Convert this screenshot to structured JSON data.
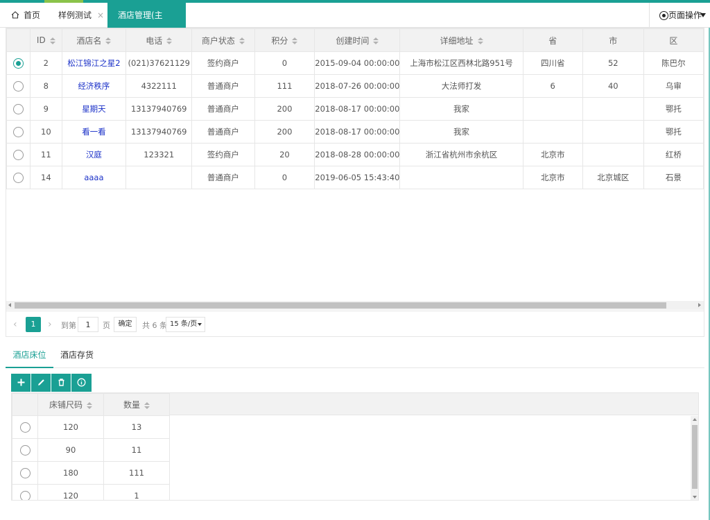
{
  "colors": {
    "accent": "#1aa094",
    "link": "#1b31c8"
  },
  "tabs": {
    "home": "首页",
    "sample": "样例测试",
    "active": "酒店管理(主子)",
    "page_ops": "页面操作"
  },
  "grid": {
    "columns": [
      "ID",
      "酒店名",
      "电话",
      "商户状态",
      "积分",
      "创建时间",
      "详细地址",
      "省",
      "市",
      "区"
    ],
    "rows": [
      {
        "selected": true,
        "id": "2",
        "name": "松江锦江之星2",
        "phone": "(021)37621129",
        "status": "签约商户",
        "points": "0",
        "created": "2015-09-04 00:00:00",
        "address": "上海市松江区西林北路951号",
        "province": "四川省",
        "city": "52",
        "district": "陈巴尔"
      },
      {
        "selected": false,
        "id": "8",
        "name": "经济秩序",
        "phone": "4322111",
        "status": "普通商户",
        "points": "111",
        "created": "2018-07-26 00:00:00",
        "address": "大法师打发",
        "province": "6",
        "city": "40",
        "district": "乌审"
      },
      {
        "selected": false,
        "id": "9",
        "name": "星期天",
        "phone": "13137940769",
        "status": "普通商户",
        "points": "200",
        "created": "2018-08-17 00:00:00",
        "address": "我家",
        "province": "",
        "city": "",
        "district": "鄂托"
      },
      {
        "selected": false,
        "id": "10",
        "name": "看一看",
        "phone": "13137940769",
        "status": "普通商户",
        "points": "200",
        "created": "2018-08-17 00:00:00",
        "address": "我家",
        "province": "",
        "city": "",
        "district": "鄂托"
      },
      {
        "selected": false,
        "id": "11",
        "name": "汉庭",
        "phone": "123321",
        "status": "签约商户",
        "points": "20",
        "created": "2018-08-28 00:00:00",
        "address": "浙江省杭州市余杭区",
        "province": "北京市",
        "city": "",
        "district": "红桥"
      },
      {
        "selected": false,
        "id": "14",
        "name": "aaaa",
        "phone": "",
        "status": "普通商户",
        "points": "0",
        "created": "2019-06-05 15:43:40",
        "address": "",
        "province": "北京市",
        "city": "北京城区",
        "district": "石景"
      }
    ]
  },
  "pager": {
    "prev": "‹",
    "current_page": "1",
    "next": "›",
    "goto_label": "到第",
    "page_input": "1",
    "page_unit": "页",
    "confirm": "确定",
    "total": "共 6 条",
    "page_size": "15 条/页"
  },
  "subtabs": {
    "beds": "酒店床位",
    "stock": "酒店存货"
  },
  "toolbar": {
    "icons": [
      "plus-icon",
      "edit-icon",
      "delete-icon",
      "info-icon"
    ]
  },
  "sub_grid": {
    "columns": [
      "床铺尺码",
      "数量"
    ],
    "rows": [
      {
        "size": "120",
        "qty": "13"
      },
      {
        "size": "90",
        "qty": "11"
      },
      {
        "size": "180",
        "qty": "111"
      },
      {
        "size": "120",
        "qty": "1"
      }
    ]
  }
}
